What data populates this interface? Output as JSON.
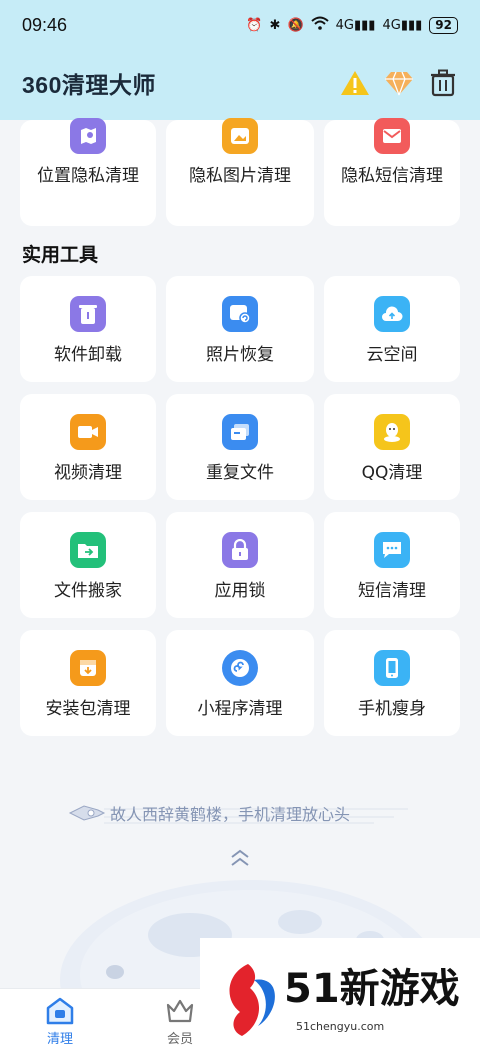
{
  "status_bar": {
    "time": "09:46",
    "signal1": "4G",
    "signal2": "4G",
    "battery": "92"
  },
  "app": {
    "title": "360清理大师"
  },
  "privacy_tools": [
    {
      "label": "位置隐私清理",
      "icon": "location-privacy-icon",
      "color": "#8b78e6"
    },
    {
      "label": "隐私图片清理",
      "icon": "private-photo-icon",
      "color": "#f5a623"
    },
    {
      "label": "隐私短信清理",
      "icon": "private-sms-icon",
      "color": "#f25b5b"
    }
  ],
  "section": {
    "title": "实用工具"
  },
  "tools": [
    {
      "label": "软件卸载",
      "icon": "uninstall-icon",
      "color": "#8b78e6"
    },
    {
      "label": "照片恢复",
      "icon": "photo-restore-icon",
      "color": "#3b8cf0"
    },
    {
      "label": "云空间",
      "icon": "cloud-icon",
      "color": "#3bb3f5"
    },
    {
      "label": "视频清理",
      "icon": "video-icon",
      "color": "#f59a1b"
    },
    {
      "label": "重复文件",
      "icon": "duplicate-file-icon",
      "color": "#3b8cf0"
    },
    {
      "label": "QQ清理",
      "icon": "qq-icon",
      "color": "#f5c51b"
    },
    {
      "label": "文件搬家",
      "icon": "file-move-icon",
      "color": "#23c07a"
    },
    {
      "label": "应用锁",
      "icon": "app-lock-icon",
      "color": "#8b78e6"
    },
    {
      "label": "短信清理",
      "icon": "sms-icon",
      "color": "#3bb3f5"
    },
    {
      "label": "安装包清理",
      "icon": "package-icon",
      "color": "#f59a1b"
    },
    {
      "label": "小程序清理",
      "icon": "mini-program-icon",
      "color": "#3b8cf0"
    },
    {
      "label": "手机瘦身",
      "icon": "phone-slim-icon",
      "color": "#3bb3f5"
    }
  ],
  "slogan": "故人西辞黄鹤楼，手机清理放心头",
  "bottom_nav": [
    {
      "label": "清理",
      "active": true
    },
    {
      "label": "会员",
      "active": false
    }
  ],
  "watermark": {
    "brand": "51新游戏",
    "url": "51chengyu.com"
  }
}
